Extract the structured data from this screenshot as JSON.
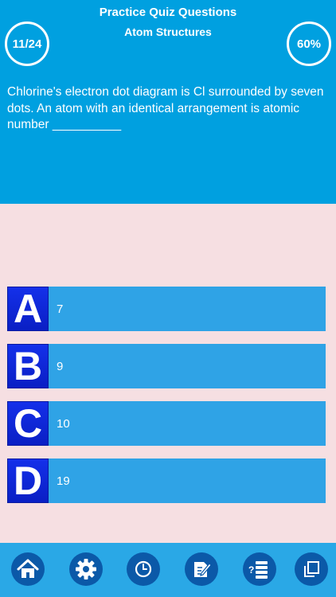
{
  "header": {
    "title": "Practice Quiz Questions",
    "subtitle": "Atom Structures",
    "progress": "11/24",
    "score": "60%"
  },
  "question": {
    "text": "Chlorine's electron dot diagram is Cl surrounded by seven dots. An atom with an identical arrangement is atomic number __________"
  },
  "answers": [
    {
      "letter": "A",
      "text": "7"
    },
    {
      "letter": "B",
      "text": "9"
    },
    {
      "letter": "C",
      "text": "10"
    },
    {
      "letter": "D",
      "text": "19"
    }
  ],
  "toolbar": {
    "icons": [
      "home-icon",
      "gear-icon",
      "clock-icon",
      "edit-note-icon",
      "question-list-icon",
      "copy-icon"
    ]
  },
  "colors": {
    "header_bg": "#00a0e0",
    "body_bg": "#f6dfe2",
    "answer_bg": "#2fa3e6",
    "letter_bg": "#1430ea",
    "toolbar_bg": "#2aa8e6",
    "toolbar_button": "#0b59a8"
  }
}
